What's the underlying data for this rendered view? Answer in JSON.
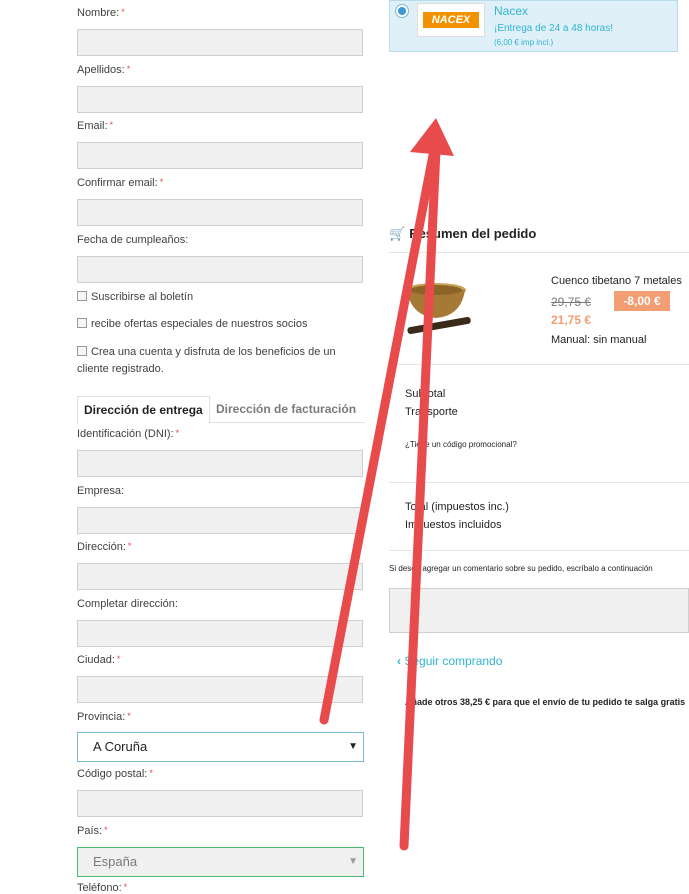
{
  "form": {
    "nombre": "Nombre:",
    "apellidos": "Apellidos:",
    "email": "Email:",
    "confirmar_email": "Confirmar email:",
    "fecha": "Fecha de cumpleaños:",
    "boletin": "Suscribirse al boletín",
    "ofertas": "recibe ofertas especiales de nuestros socios",
    "cuenta_line1": "Crea una cuenta y disfruta de los beneficios de un",
    "cuenta_line2": "cliente registrado.",
    "required_mark": "*"
  },
  "tabs": {
    "entrega": "Dirección de entrega",
    "facturacion": "Dirección de facturación"
  },
  "address": {
    "dni": "Identificación (DNI):",
    "empresa": "Empresa:",
    "direccion": "Dirección:",
    "completar": "Completar dirección:",
    "ciudad": "Ciudad:",
    "provincia": "Provincia:",
    "provincia_value": "A Coruña",
    "cp": "Código postal:",
    "pais": "País:",
    "pais_value": "España",
    "telefono": "Teléfono:"
  },
  "shipping": {
    "carrier_logo": "NACEX",
    "carrier_name": "Nacex",
    "delivery": "¡Entrega de 24 a 48 horas!",
    "price": "(6,00 € imp incl.)"
  },
  "summary": {
    "title": "Resumen del pedido",
    "product_name": "Cuenco tibetano 7 metales",
    "old_price": "29,75 €",
    "discount": "-8,00 €",
    "new_price": "21,75 €",
    "manual": "Manual: sin manual",
    "subtotal": "Subtotal",
    "transporte": "Transporte",
    "promo": "¿Tiene un código promocional?",
    "total": "Total (impuestos inc.)",
    "impuestos": "Impuestos incluidos",
    "comment_hint": "Si desea agregar un comentario sobre su pedido, escríbalo a continuación",
    "seguir": "Seguir comprando",
    "free_shipping": "Añade otros 38,25 € para que el envío de tu pedido te salga gratis"
  },
  "colors": {
    "accent": "#2fb5d2",
    "discount": "#f39d72",
    "arrow": "#e84b4b",
    "required": "#e84a4a"
  }
}
